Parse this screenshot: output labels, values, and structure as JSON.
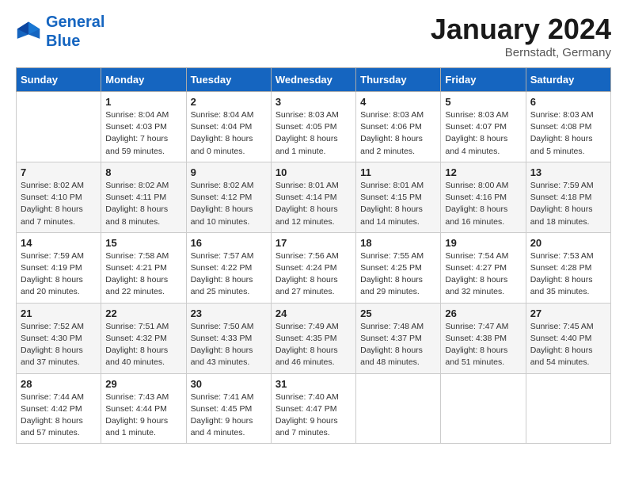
{
  "app": {
    "logo_line1": "General",
    "logo_line2": "Blue"
  },
  "calendar": {
    "month_title": "January 2024",
    "location": "Bernstadt, Germany",
    "day_headers": [
      "Sunday",
      "Monday",
      "Tuesday",
      "Wednesday",
      "Thursday",
      "Friday",
      "Saturday"
    ],
    "weeks": [
      [
        {
          "day": "",
          "info": ""
        },
        {
          "day": "1",
          "info": "Sunrise: 8:04 AM\nSunset: 4:03 PM\nDaylight: 7 hours\nand 59 minutes."
        },
        {
          "day": "2",
          "info": "Sunrise: 8:04 AM\nSunset: 4:04 PM\nDaylight: 8 hours\nand 0 minutes."
        },
        {
          "day": "3",
          "info": "Sunrise: 8:03 AM\nSunset: 4:05 PM\nDaylight: 8 hours\nand 1 minute."
        },
        {
          "day": "4",
          "info": "Sunrise: 8:03 AM\nSunset: 4:06 PM\nDaylight: 8 hours\nand 2 minutes."
        },
        {
          "day": "5",
          "info": "Sunrise: 8:03 AM\nSunset: 4:07 PM\nDaylight: 8 hours\nand 4 minutes."
        },
        {
          "day": "6",
          "info": "Sunrise: 8:03 AM\nSunset: 4:08 PM\nDaylight: 8 hours\nand 5 minutes."
        }
      ],
      [
        {
          "day": "7",
          "info": "Sunrise: 8:02 AM\nSunset: 4:10 PM\nDaylight: 8 hours\nand 7 minutes."
        },
        {
          "day": "8",
          "info": "Sunrise: 8:02 AM\nSunset: 4:11 PM\nDaylight: 8 hours\nand 8 minutes."
        },
        {
          "day": "9",
          "info": "Sunrise: 8:02 AM\nSunset: 4:12 PM\nDaylight: 8 hours\nand 10 minutes."
        },
        {
          "day": "10",
          "info": "Sunrise: 8:01 AM\nSunset: 4:14 PM\nDaylight: 8 hours\nand 12 minutes."
        },
        {
          "day": "11",
          "info": "Sunrise: 8:01 AM\nSunset: 4:15 PM\nDaylight: 8 hours\nand 14 minutes."
        },
        {
          "day": "12",
          "info": "Sunrise: 8:00 AM\nSunset: 4:16 PM\nDaylight: 8 hours\nand 16 minutes."
        },
        {
          "day": "13",
          "info": "Sunrise: 7:59 AM\nSunset: 4:18 PM\nDaylight: 8 hours\nand 18 minutes."
        }
      ],
      [
        {
          "day": "14",
          "info": "Sunrise: 7:59 AM\nSunset: 4:19 PM\nDaylight: 8 hours\nand 20 minutes."
        },
        {
          "day": "15",
          "info": "Sunrise: 7:58 AM\nSunset: 4:21 PM\nDaylight: 8 hours\nand 22 minutes."
        },
        {
          "day": "16",
          "info": "Sunrise: 7:57 AM\nSunset: 4:22 PM\nDaylight: 8 hours\nand 25 minutes."
        },
        {
          "day": "17",
          "info": "Sunrise: 7:56 AM\nSunset: 4:24 PM\nDaylight: 8 hours\nand 27 minutes."
        },
        {
          "day": "18",
          "info": "Sunrise: 7:55 AM\nSunset: 4:25 PM\nDaylight: 8 hours\nand 29 minutes."
        },
        {
          "day": "19",
          "info": "Sunrise: 7:54 AM\nSunset: 4:27 PM\nDaylight: 8 hours\nand 32 minutes."
        },
        {
          "day": "20",
          "info": "Sunrise: 7:53 AM\nSunset: 4:28 PM\nDaylight: 8 hours\nand 35 minutes."
        }
      ],
      [
        {
          "day": "21",
          "info": "Sunrise: 7:52 AM\nSunset: 4:30 PM\nDaylight: 8 hours\nand 37 minutes."
        },
        {
          "day": "22",
          "info": "Sunrise: 7:51 AM\nSunset: 4:32 PM\nDaylight: 8 hours\nand 40 minutes."
        },
        {
          "day": "23",
          "info": "Sunrise: 7:50 AM\nSunset: 4:33 PM\nDaylight: 8 hours\nand 43 minutes."
        },
        {
          "day": "24",
          "info": "Sunrise: 7:49 AM\nSunset: 4:35 PM\nDaylight: 8 hours\nand 46 minutes."
        },
        {
          "day": "25",
          "info": "Sunrise: 7:48 AM\nSunset: 4:37 PM\nDaylight: 8 hours\nand 48 minutes."
        },
        {
          "day": "26",
          "info": "Sunrise: 7:47 AM\nSunset: 4:38 PM\nDaylight: 8 hours\nand 51 minutes."
        },
        {
          "day": "27",
          "info": "Sunrise: 7:45 AM\nSunset: 4:40 PM\nDaylight: 8 hours\nand 54 minutes."
        }
      ],
      [
        {
          "day": "28",
          "info": "Sunrise: 7:44 AM\nSunset: 4:42 PM\nDaylight: 8 hours\nand 57 minutes."
        },
        {
          "day": "29",
          "info": "Sunrise: 7:43 AM\nSunset: 4:44 PM\nDaylight: 9 hours\nand 1 minute."
        },
        {
          "day": "30",
          "info": "Sunrise: 7:41 AM\nSunset: 4:45 PM\nDaylight: 9 hours\nand 4 minutes."
        },
        {
          "day": "31",
          "info": "Sunrise: 7:40 AM\nSunset: 4:47 PM\nDaylight: 9 hours\nand 7 minutes."
        },
        {
          "day": "",
          "info": ""
        },
        {
          "day": "",
          "info": ""
        },
        {
          "day": "",
          "info": ""
        }
      ]
    ]
  }
}
